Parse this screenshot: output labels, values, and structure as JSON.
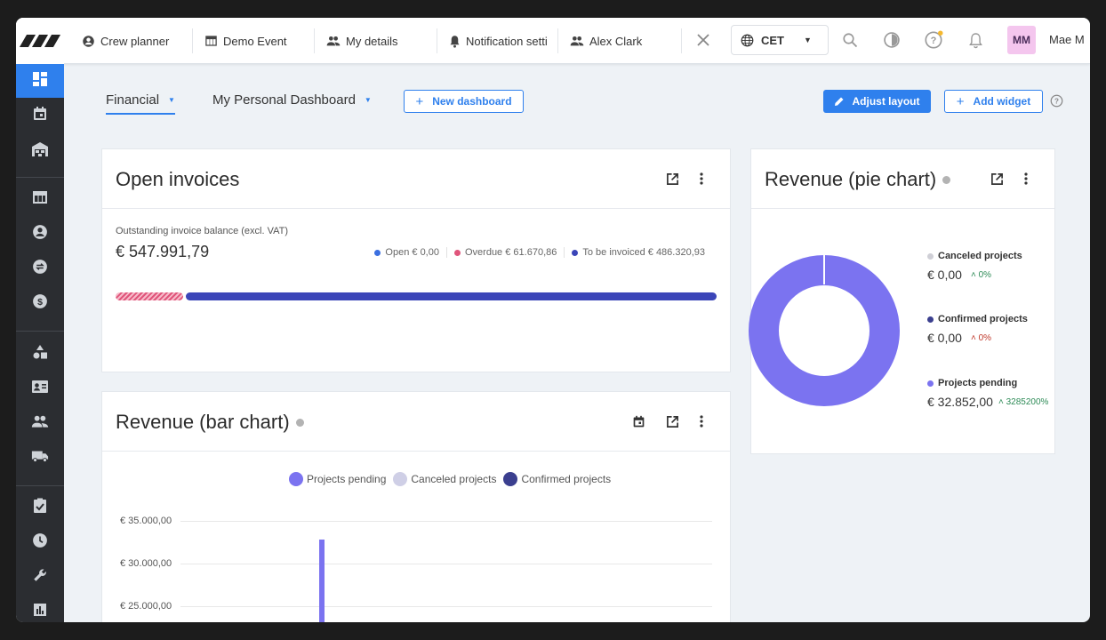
{
  "topbar": {
    "tabs": [
      {
        "label": "Crew planner",
        "icon": "account-circle-icon"
      },
      {
        "label": "Demo Event",
        "icon": "table-icon"
      },
      {
        "label": "My details",
        "icon": "people-icon"
      },
      {
        "label": "Notification setti",
        "icon": "bell-icon"
      },
      {
        "label": "Alex Clark",
        "icon": "people-icon"
      }
    ],
    "timezone": "CET",
    "avatar_initials": "MM",
    "user_name": "Mae M"
  },
  "dashboard": {
    "tabs": [
      "Financial",
      "My Personal Dashboard"
    ],
    "new_dashboard": "New dashboard",
    "adjust_layout": "Adjust layout",
    "add_widget": "Add widget"
  },
  "open_invoices": {
    "title": "Open invoices",
    "caption": "Outstanding invoice balance (excl. VAT)",
    "total": "€ 547.991,79",
    "legend": [
      {
        "label": "Open",
        "value": "€ 0,00",
        "color": "#3b6fe0"
      },
      {
        "label": "Overdue",
        "value": "€ 61.670,86",
        "color": "#e0557b"
      },
      {
        "label": "To be invoiced",
        "value": "€ 486.320,93",
        "color": "#3b45b8"
      }
    ],
    "overdue_fraction": 0.113,
    "to_be_invoiced_fraction": 0.887
  },
  "revenue_pie": {
    "title": "Revenue (pie chart)",
    "items": [
      {
        "label": "Canceled projects",
        "value": "€ 0,00",
        "change": "0%",
        "color": "#cfcfd6",
        "change_color": "#2e8b57"
      },
      {
        "label": "Confirmed projects",
        "value": "€ 0,00",
        "change": "0%",
        "color": "#3b3f8f",
        "change_color": "#c0392b"
      },
      {
        "label": "Projects pending",
        "value": "€ 32.852,00",
        "change": "3285200%",
        "color": "#7b73f0",
        "change_color": "#2e8b57"
      }
    ]
  },
  "chart_data": {
    "type": "bar",
    "title": "Revenue (bar chart)",
    "series": [
      {
        "name": "Projects pending",
        "color": "#7b73f0"
      },
      {
        "name": "Canceled projects",
        "color": "#cfcfe6"
      },
      {
        "name": "Confirmed projects",
        "color": "#3b3f8f"
      }
    ],
    "yticks": [
      "€ 35.000,00",
      "€ 30.000,00",
      "€ 25.000,00"
    ],
    "ytick_values": [
      35000,
      30000,
      25000
    ],
    "bars": [
      {
        "series": "Projects pending",
        "value": 32852
      }
    ],
    "grid": true,
    "legend_position": "top"
  }
}
